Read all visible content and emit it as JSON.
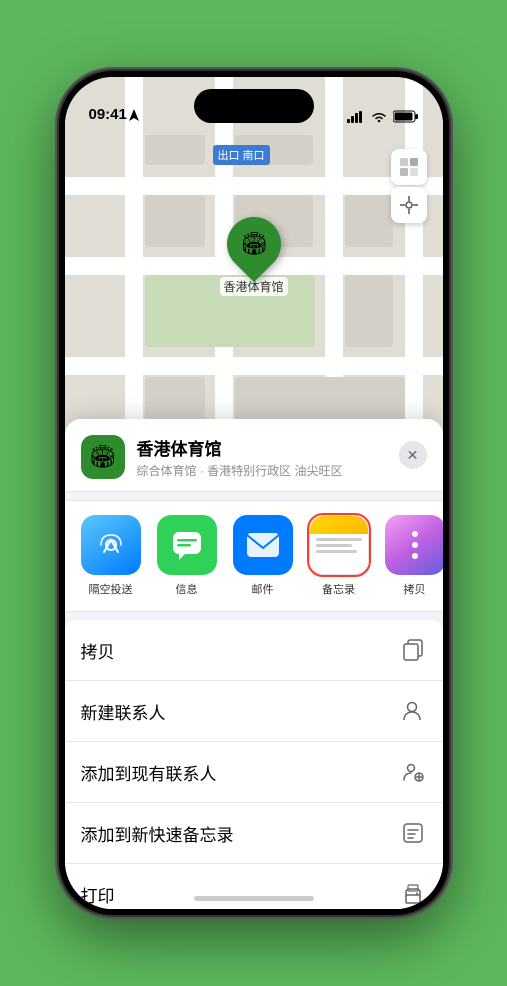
{
  "statusBar": {
    "time": "09:41",
    "locationArrow": true
  },
  "map": {
    "label": "南口",
    "labelPrefix": "出口"
  },
  "venue": {
    "name": "香港体育馆",
    "description": "综合体育馆 · 香港特别行政区 油尖旺区"
  },
  "shareApps": [
    {
      "id": "airdrop",
      "label": "隔空投送",
      "type": "airdrop"
    },
    {
      "id": "messages",
      "label": "信息",
      "type": "messages"
    },
    {
      "id": "mail",
      "label": "邮件",
      "type": "mail"
    },
    {
      "id": "notes",
      "label": "备忘录",
      "type": "notes",
      "selected": true
    },
    {
      "id": "more",
      "label": "拷贝",
      "type": "more"
    }
  ],
  "actions": [
    {
      "id": "copy",
      "label": "拷贝",
      "icon": "copy"
    },
    {
      "id": "new-contact",
      "label": "新建联系人",
      "icon": "person-add"
    },
    {
      "id": "add-existing",
      "label": "添加到现有联系人",
      "icon": "person-circle-add"
    },
    {
      "id": "quick-note",
      "label": "添加到新快速备忘录",
      "icon": "note-add"
    },
    {
      "id": "print",
      "label": "打印",
      "icon": "printer"
    }
  ],
  "pinLabel": "香港体育馆"
}
